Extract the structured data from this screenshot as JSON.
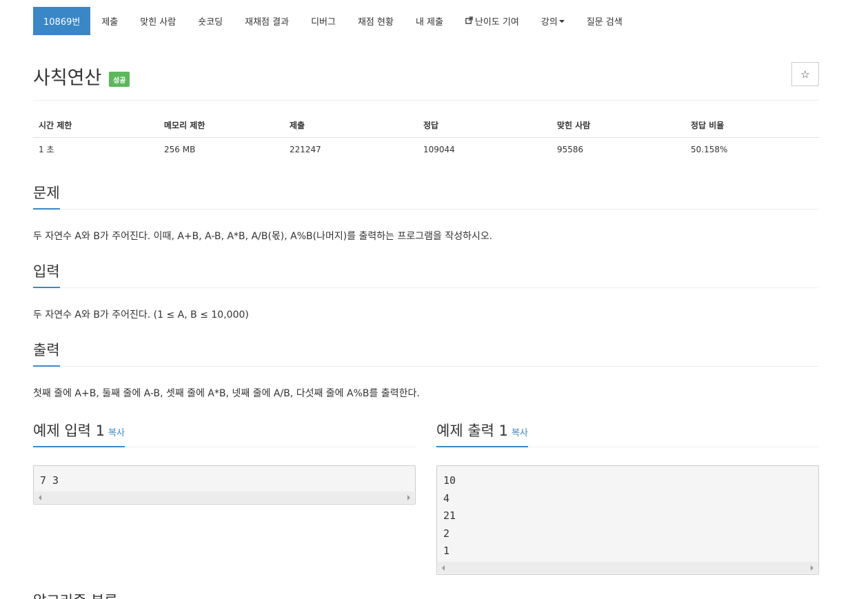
{
  "nav": {
    "items": [
      {
        "label": "10869번",
        "active": true
      },
      {
        "label": "제출"
      },
      {
        "label": "맞힌 사람"
      },
      {
        "label": "숏코딩"
      },
      {
        "label": "재채점 결과"
      },
      {
        "label": "디버그"
      },
      {
        "label": "채점 현황"
      },
      {
        "label": "내 제출"
      },
      {
        "label": "난이도 기여",
        "icon": "external-link-icon"
      },
      {
        "label": "강의",
        "dropdown": true
      },
      {
        "label": "질문 검색"
      }
    ]
  },
  "problem": {
    "title": "사칙연산",
    "badge": "성공",
    "star_icon": "☆"
  },
  "info_table": {
    "headers": [
      "시간 제한",
      "메모리 제한",
      "제출",
      "정답",
      "맞힌 사람",
      "정답 비율"
    ],
    "values": [
      "1 초",
      "256 MB",
      "221247",
      "109044",
      "95586",
      "50.158%"
    ]
  },
  "sections": {
    "description": {
      "title": "문제",
      "text": "두 자연수 A와 B가 주어진다. 이때, A+B, A-B, A*B, A/B(몫), A%B(나머지)를 출력하는 프로그램을 작성하시오."
    },
    "input": {
      "title": "입력",
      "text": "두 자연수 A와 B가 주어진다. (1 ≤ A, B ≤ 10,000)"
    },
    "output": {
      "title": "출력",
      "text": "첫째 줄에 A+B, 둘째 줄에 A-B, 셋째 줄에 A*B, 넷째 줄에 A/B, 다섯째 줄에 A%B를 출력한다."
    }
  },
  "samples": {
    "input": {
      "title": "예제 입력 1",
      "copy_label": "복사",
      "lines": [
        "7 3"
      ]
    },
    "output": {
      "title": "예제 출력 1",
      "copy_label": "복사",
      "lines": [
        "10",
        "4",
        "21",
        "2",
        "1"
      ]
    }
  },
  "next_section_title": "알고리즘 분류",
  "colors": {
    "accent": "#3a87c8",
    "success_badge": "#5cb85c"
  }
}
